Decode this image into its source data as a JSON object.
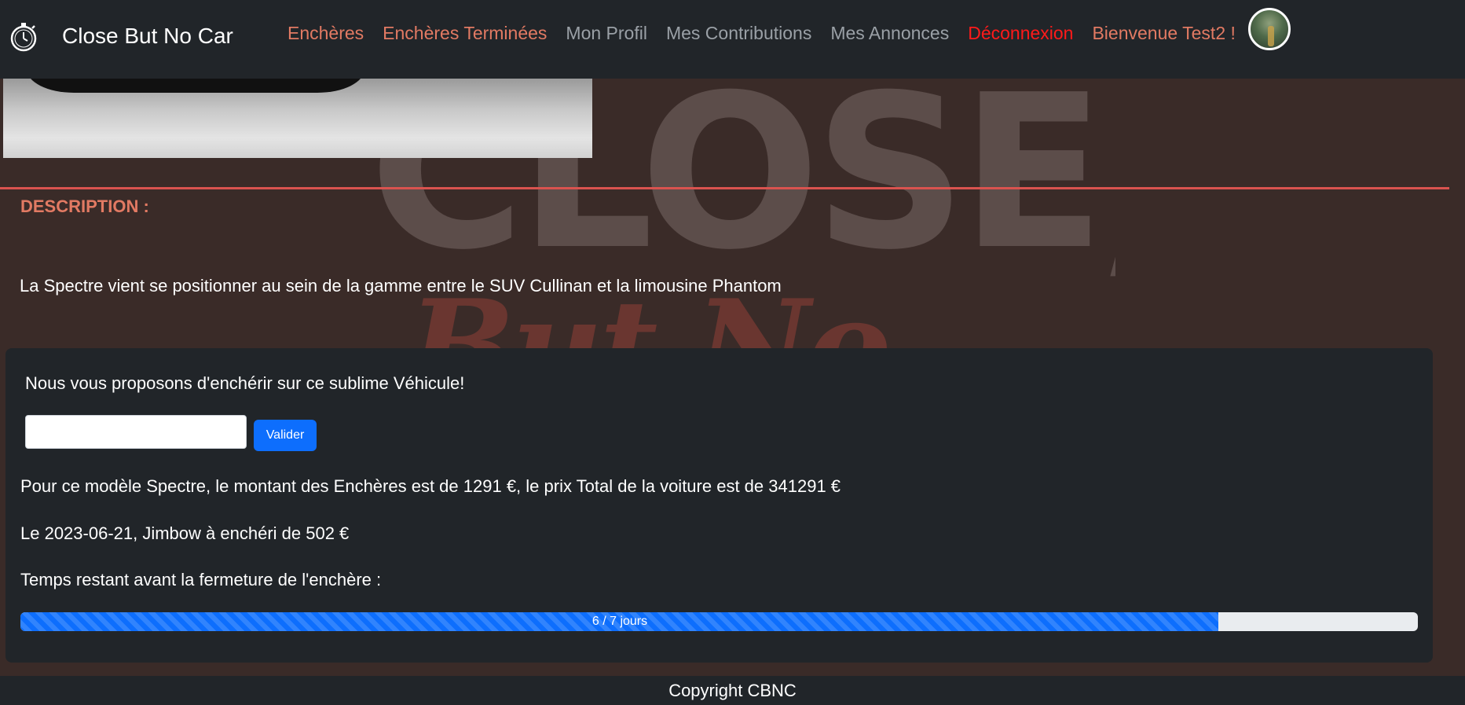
{
  "navbar": {
    "brand": "Close But No Car",
    "links": [
      {
        "label": "Enchères"
      },
      {
        "label": "Enchères Terminées"
      },
      {
        "label": "Mon Profil"
      },
      {
        "label": "Mes Contributions"
      },
      {
        "label": "Mes Annonces"
      },
      {
        "label": "Déconnexion"
      },
      {
        "label": "Bienvenue Test2 !"
      }
    ]
  },
  "background_logo": {
    "line1": "CLOSE,",
    "line2": "But No Car"
  },
  "description": {
    "heading": "DESCRIPTION :",
    "text": "La Spectre vient se positionner au sein de la gamme entre le SUV Cullinan et la limousine Phantom"
  },
  "bid": {
    "intro": "Nous vous proposons d'enchérir sur ce sublime Véhicule!",
    "input_value": "",
    "button_label": "Valider",
    "summary": "Pour ce modèle Spectre, le montant des Enchères est de 1291 €, le prix Total de la voiture est de 341291 €",
    "last_bid": "Le 2023-06-21, Jimbow à enchéri de 502 €",
    "time_label": "Temps restant avant la fermeture de l'enchère :",
    "progress": {
      "label": "6 / 7 jours",
      "fraction": 0.857
    }
  },
  "footer": {
    "copyright": "Copyright CBNC"
  },
  "colors": {
    "navbar_bg": "#212529",
    "page_bg": "#3a2b28",
    "accent": "#e27a63",
    "danger": "#ff1a1a",
    "primary": "#0d6efd",
    "separator": "#d9534f"
  }
}
